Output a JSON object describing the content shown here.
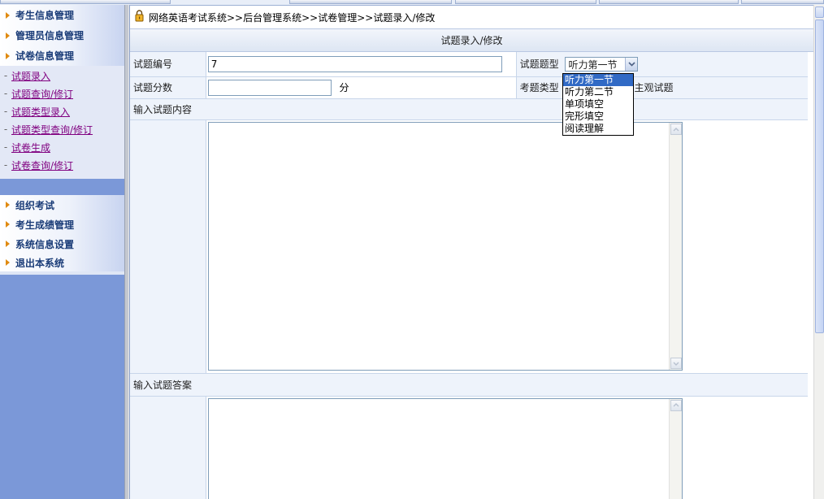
{
  "sidebar": {
    "top_groups": [
      {
        "label": "考生信息管理"
      },
      {
        "label": "管理员信息管理"
      },
      {
        "label": "试卷信息管理"
      }
    ],
    "sub_items": [
      {
        "label": "试题录入"
      },
      {
        "label": "试题查询/修订"
      },
      {
        "label": "试题类型录入"
      },
      {
        "label": "试题类型查询/修订"
      },
      {
        "label": "试卷生成"
      },
      {
        "label": "试卷查询/修订"
      }
    ],
    "bottom_groups": [
      {
        "label": "组织考试"
      },
      {
        "label": "考生成绩管理"
      },
      {
        "label": "系统信息设置"
      },
      {
        "label": "退出本系统"
      }
    ]
  },
  "breadcrumb": "网络英语考试系统>>后台管理系统>>试卷管理>>试题录入/修改",
  "panel_title": "试题录入/修改",
  "form": {
    "id_label": "试题编号",
    "id_value": "7",
    "type_label": "试题题型",
    "type_selected": "听力第一节",
    "score_label": "试题分数",
    "score_value": "",
    "score_unit": "分",
    "category_label": "考题类型",
    "category_value": "主观试题",
    "content_label": "输入试题内容",
    "answer_label": "输入试题答案"
  },
  "dropdown_options": [
    "听力第一节",
    "听力第二节",
    "单项填空",
    "完形填空",
    "阅读理解"
  ],
  "colors": {
    "sidebar_bg": "#7b98d8",
    "menu_text": "#1a3c78",
    "link_visited": "#800080",
    "selected_option": "#316ac5"
  }
}
